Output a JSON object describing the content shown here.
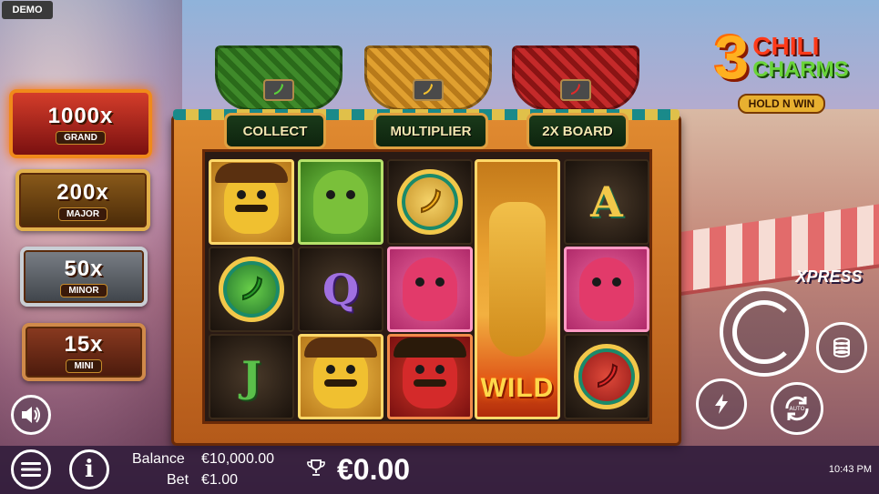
{
  "badge": "DEMO",
  "jackpots": [
    {
      "amount": "1000x",
      "tier": "GRAND"
    },
    {
      "amount": "200x",
      "tier": "MAJOR"
    },
    {
      "amount": "50x",
      "tier": "MINOR"
    },
    {
      "amount": "15x",
      "tier": "MINI"
    }
  ],
  "logo": {
    "number": "3",
    "word1": "CHILI",
    "word2": "CHARMS",
    "subtitle": "HOLD N WIN"
  },
  "features": {
    "collect": "COLLECT",
    "multiplier": "MULTIPLIER",
    "board": "2X BOARD"
  },
  "reels": {
    "letters": {
      "a": "A",
      "q": "Q",
      "j": "J"
    },
    "wild": "WILD"
  },
  "controls": {
    "xpress": "XPRESS",
    "auto_label": "AUTO"
  },
  "bottom": {
    "balance_label": "Balance",
    "balance_value": "€10,000.00",
    "bet_label": "Bet",
    "bet_value": "€1.00",
    "win_value": "€0.00",
    "time": "10:43 PM"
  },
  "colors": {
    "accent": "#e0a040",
    "frame": "#b45a1a"
  }
}
